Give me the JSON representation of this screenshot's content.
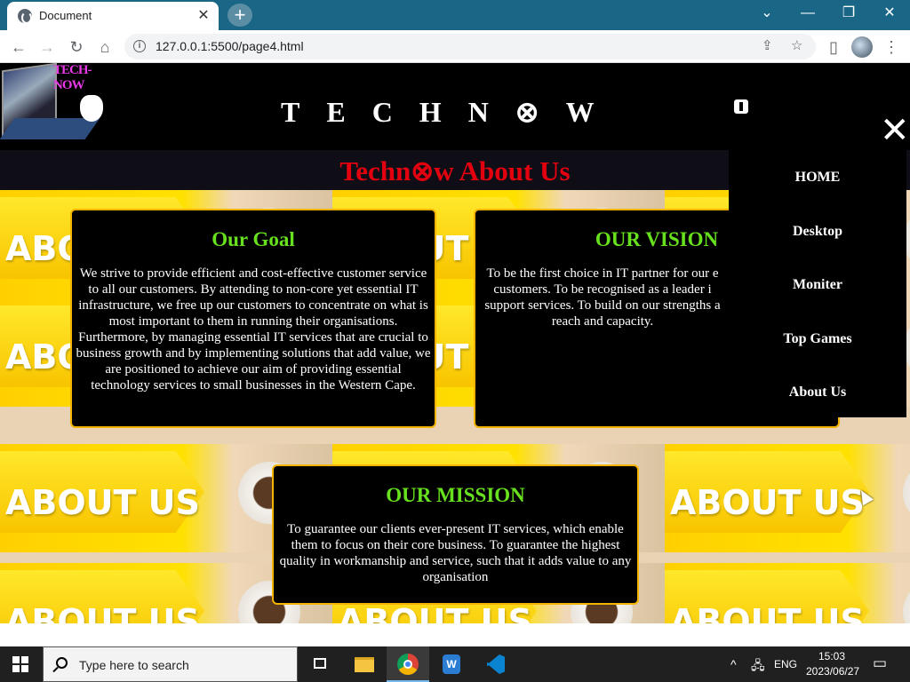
{
  "browser": {
    "tab_title": "Document",
    "tab_close": "✕",
    "new_tab": "+",
    "url": "127.0.0.1:5500/page4.html",
    "window_controls": [
      "⌄",
      "—",
      "❐",
      "✕"
    ]
  },
  "header": {
    "logo_text": "TECH-NOW",
    "brand": [
      "T",
      "E",
      "C",
      "H",
      "N",
      "⊗",
      "W"
    ]
  },
  "page": {
    "title": "Techn⊗w About Us",
    "background_text": "ABOUT US"
  },
  "cards": {
    "goal": {
      "title": "Our Goal",
      "body": "We strive to provide efficient and cost-effective customer service to all our customers. By attending to non-core yet essential IT infrastructure, we free up our customers to concentrate on what is most important to them in running their organisations. Furthermore, by managing essential IT services that are crucial to business growth and by implementing solutions that add value, we are positioned to achieve our aim of providing essential technology services to small businesses in the Western Cape."
    },
    "vision": {
      "title": "OUR VISION",
      "body": "To be the first choice in IT partner for our e customers. To be recognised as a leader i support services. To build on our strengths a reach and capacity."
    },
    "mission": {
      "title": "OUR MISSION",
      "body": "To guarantee our clients ever-present IT services, which enable them to focus on their core business. To guarantee the highest quality in workmanship and service, such that it adds value to any organisation"
    }
  },
  "sidenav": {
    "close": "✕",
    "items": [
      "HOME",
      "Desktop",
      "Moniter",
      "Top Games",
      "About Us"
    ]
  },
  "taskbar": {
    "search_placeholder": "Type here to search",
    "language": "ENG",
    "time": "15:03",
    "date": "2023/06/27"
  },
  "colors": {
    "tabbar": "#196687",
    "card_title": "#67e01d",
    "card_border": "#f3b300",
    "page_title": "#e3000f"
  }
}
